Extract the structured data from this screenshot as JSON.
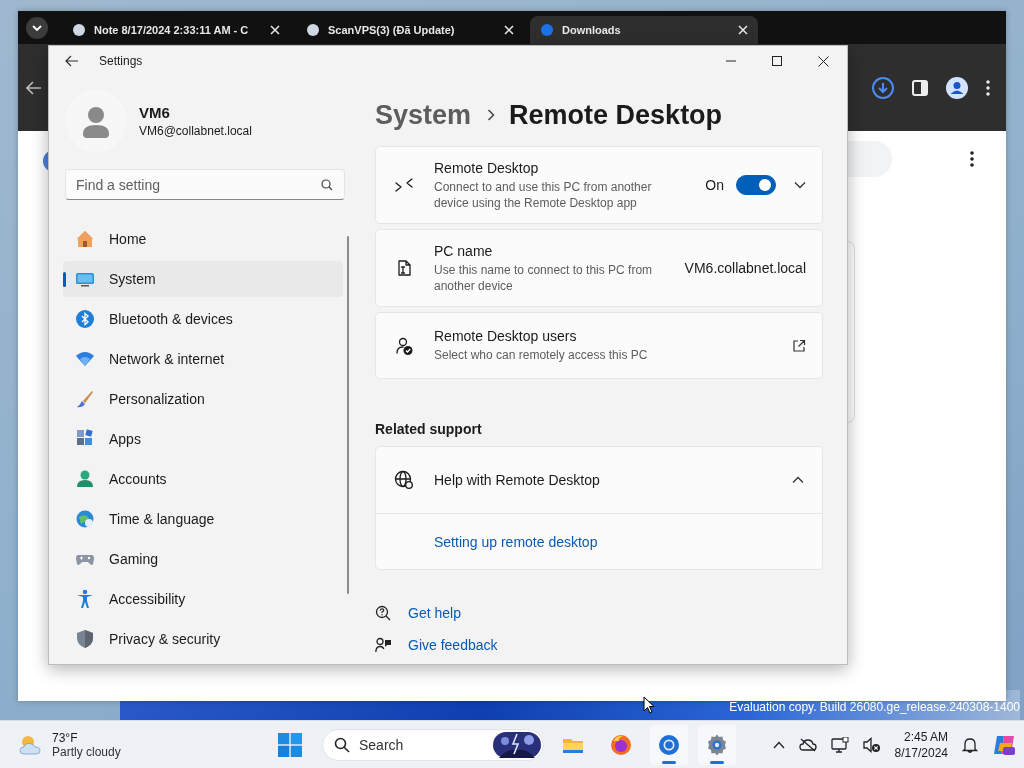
{
  "desktop": {
    "watermark": "Evaluation copy. Build 26080.ge_release.240308-1400"
  },
  "browser": {
    "tabs": [
      {
        "title": "Note 8/17/2024 2:33:11 AM - C",
        "selected": false
      },
      {
        "title": "ScanVPS(3) (Đã Update)",
        "selected": false
      },
      {
        "title": "Downloads",
        "selected": true
      }
    ]
  },
  "settings": {
    "title": "Settings",
    "user": {
      "name": "VM6",
      "email": "VM6@collabnet.local"
    },
    "search": {
      "placeholder": "Find a setting"
    },
    "nav": [
      {
        "label": "Home",
        "selected": false
      },
      {
        "label": "System",
        "selected": true
      },
      {
        "label": "Bluetooth & devices",
        "selected": false
      },
      {
        "label": "Network & internet",
        "selected": false
      },
      {
        "label": "Personalization",
        "selected": false
      },
      {
        "label": "Apps",
        "selected": false
      },
      {
        "label": "Accounts",
        "selected": false
      },
      {
        "label": "Time & language",
        "selected": false
      },
      {
        "label": "Gaming",
        "selected": false
      },
      {
        "label": "Accessibility",
        "selected": false
      },
      {
        "label": "Privacy & security",
        "selected": false
      }
    ],
    "breadcrumb": {
      "parent": "System",
      "current": "Remote Desktop"
    },
    "cards": [
      {
        "kind": "toggle",
        "title": "Remote Desktop",
        "description": "Connect to and use this PC from another device using the Remote Desktop app",
        "state_label": "On",
        "on": true
      },
      {
        "kind": "value",
        "title": "PC name",
        "description": "Use this name to connect to this PC from another device",
        "value": "VM6.collabnet.local"
      },
      {
        "kind": "link",
        "title": "Remote Desktop users",
        "description": "Select who can remotely access this PC"
      }
    ],
    "related": {
      "heading": "Related support",
      "title": "Help with Remote Desktop",
      "expanded": true,
      "links": [
        "Setting up remote desktop"
      ]
    },
    "footer_links": [
      {
        "label": "Get help"
      },
      {
        "label": "Give feedback"
      }
    ]
  },
  "taskbar": {
    "weather": {
      "temp": "73°F",
      "condition": "Partly cloudy"
    },
    "search": {
      "placeholder": "Search"
    },
    "apps": [
      {
        "running": false
      },
      {
        "running": false
      },
      {
        "running": true
      },
      {
        "running": true
      }
    ],
    "clock": {
      "time": "2:45 AM",
      "date": "8/17/2024"
    }
  }
}
